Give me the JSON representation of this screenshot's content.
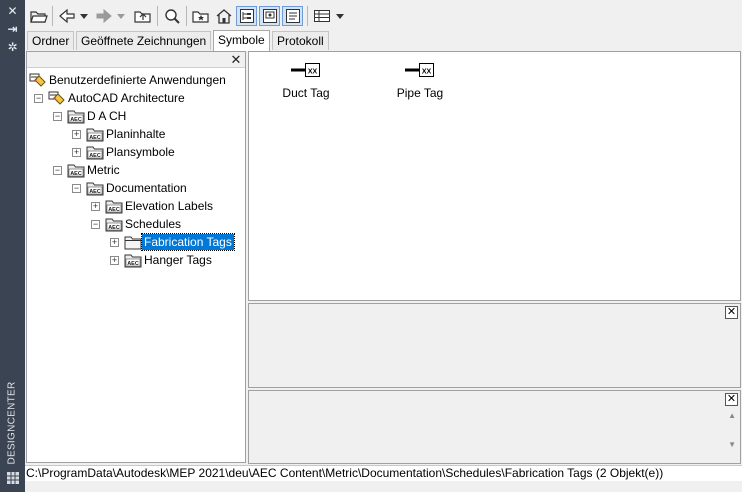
{
  "palette": {
    "title": "DESIGNCENTER",
    "close_glyph": "✕",
    "autohide_glyph": "⇥",
    "properties_glyph": "✲",
    "bottom_icon": "palette-grid-icon"
  },
  "toolbar": {
    "buttons": [
      "load-icon",
      "back-icon",
      "back-dropdown-icon",
      "forward-icon",
      "forward-dropdown-icon",
      "up-icon",
      "search-icon",
      "favorites-icon",
      "home-icon",
      "tree-view-toggle-icon",
      "preview-icon",
      "description-icon",
      "views-icon",
      "views-dropdown-icon"
    ]
  },
  "tabs": [
    {
      "label": "Ordner",
      "active": false
    },
    {
      "label": "Geöffnete Zeichnungen",
      "active": false
    },
    {
      "label": "Symbole",
      "active": true
    },
    {
      "label": "Protokoll",
      "active": false
    }
  ],
  "tree": {
    "close_glyph": "✕",
    "items": [
      {
        "label": "Benutzerdefinierte Anwendungen",
        "level": 0,
        "expander": "",
        "icon": "custom-app-icon",
        "selected": false
      },
      {
        "label": "AutoCAD Architecture",
        "level": 1,
        "expander": "−",
        "icon": "custom-app-icon",
        "selected": false
      },
      {
        "label": "D A CH",
        "level": 2,
        "expander": "−",
        "icon": "aec-folder-icon",
        "selected": false
      },
      {
        "label": "Planinhalte",
        "level": 3,
        "expander": "+",
        "icon": "aec-folder-icon",
        "selected": false
      },
      {
        "label": "Plansymbole",
        "level": 3,
        "expander": "+",
        "icon": "aec-folder-icon",
        "selected": false
      },
      {
        "label": "Metric",
        "level": 2,
        "expander": "−",
        "icon": "aec-folder-icon",
        "selected": false
      },
      {
        "label": "Documentation",
        "level": 3,
        "expander": "−",
        "icon": "aec-folder-icon",
        "selected": false
      },
      {
        "label": "Elevation Labels",
        "level": 4,
        "expander": "+",
        "icon": "aec-folder-icon",
        "selected": false
      },
      {
        "label": "Schedules",
        "level": 4,
        "expander": "−",
        "icon": "aec-folder-icon",
        "selected": false
      },
      {
        "label": "Fabrication Tags",
        "level": 5,
        "expander": "+",
        "icon": "folder-icon",
        "selected": true
      },
      {
        "label": "Hanger Tags",
        "level": 5,
        "expander": "+",
        "icon": "aec-folder-icon",
        "selected": false
      }
    ]
  },
  "content": {
    "items": [
      {
        "label": "Duct Tag",
        "tag_text": "XX"
      },
      {
        "label": "Pipe Tag",
        "tag_text": "XX"
      }
    ]
  },
  "preview": {
    "close_glyph": "✕"
  },
  "description": {
    "close_glyph": "✕"
  },
  "status": {
    "path": "C:\\ProgramData\\Autodesk\\MEP 2021\\deu\\AEC Content\\Metric\\Documentation\\Schedules\\Fabrication Tags (2 Objekt(e))"
  },
  "colors": {
    "palette_strip": "#3b4453",
    "selection": "#0078d7",
    "aec_icon_text": "#1a1a1a"
  }
}
